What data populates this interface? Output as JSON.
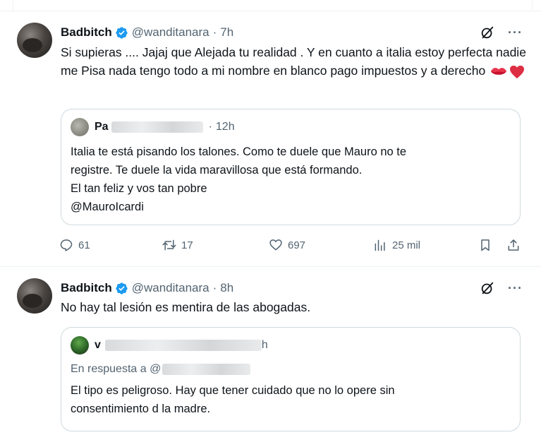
{
  "tweets": [
    {
      "author_name": "Badbitch",
      "handle": "@wanditanara",
      "separator": "·",
      "time": "7h",
      "more": "···",
      "text": "Si supieras .... Jajaj que Alejada tu realidad . Y en cuanto a italia estoy perfecta  nadie me Pisa nada tengo todo a mi nombre en blanco pago impuestos y a derecho",
      "emojis": [
        "kiss-mark-icon",
        "red-heart-icon"
      ],
      "quote": {
        "name": "Pa",
        "separator": "·",
        "time": "12h",
        "lines": [
          "Italia te está pisando los talones. Como te duele que Mauro no te",
          "registre. Te duele la vida maravillosa que está formando.",
          "El tan feliz y vos tan pobre",
          "@MauroIcardi"
        ]
      },
      "actions": {
        "replies": "61",
        "reposts": "17",
        "likes": "697",
        "views": "25 mil"
      }
    },
    {
      "author_name": "Badbitch",
      "handle": "@wanditanara",
      "separator": "·",
      "time": "8h",
      "more": "···",
      "text": "No hay tal lesión es mentira de las abogadas.",
      "quote": {
        "name": "v",
        "time_fragment": "h",
        "reply_prefix": "En respuesta a @",
        "lines": [
          "El tipo es peligroso. Hay que tener cuidado que no lo opere sin",
          "consentimiento d la madre."
        ]
      }
    }
  ],
  "colors": {
    "text": "#0f1419",
    "secondary": "#536471",
    "border": "#cfd9de",
    "verified": "#1d9bf0",
    "heart": "#e0245e"
  }
}
